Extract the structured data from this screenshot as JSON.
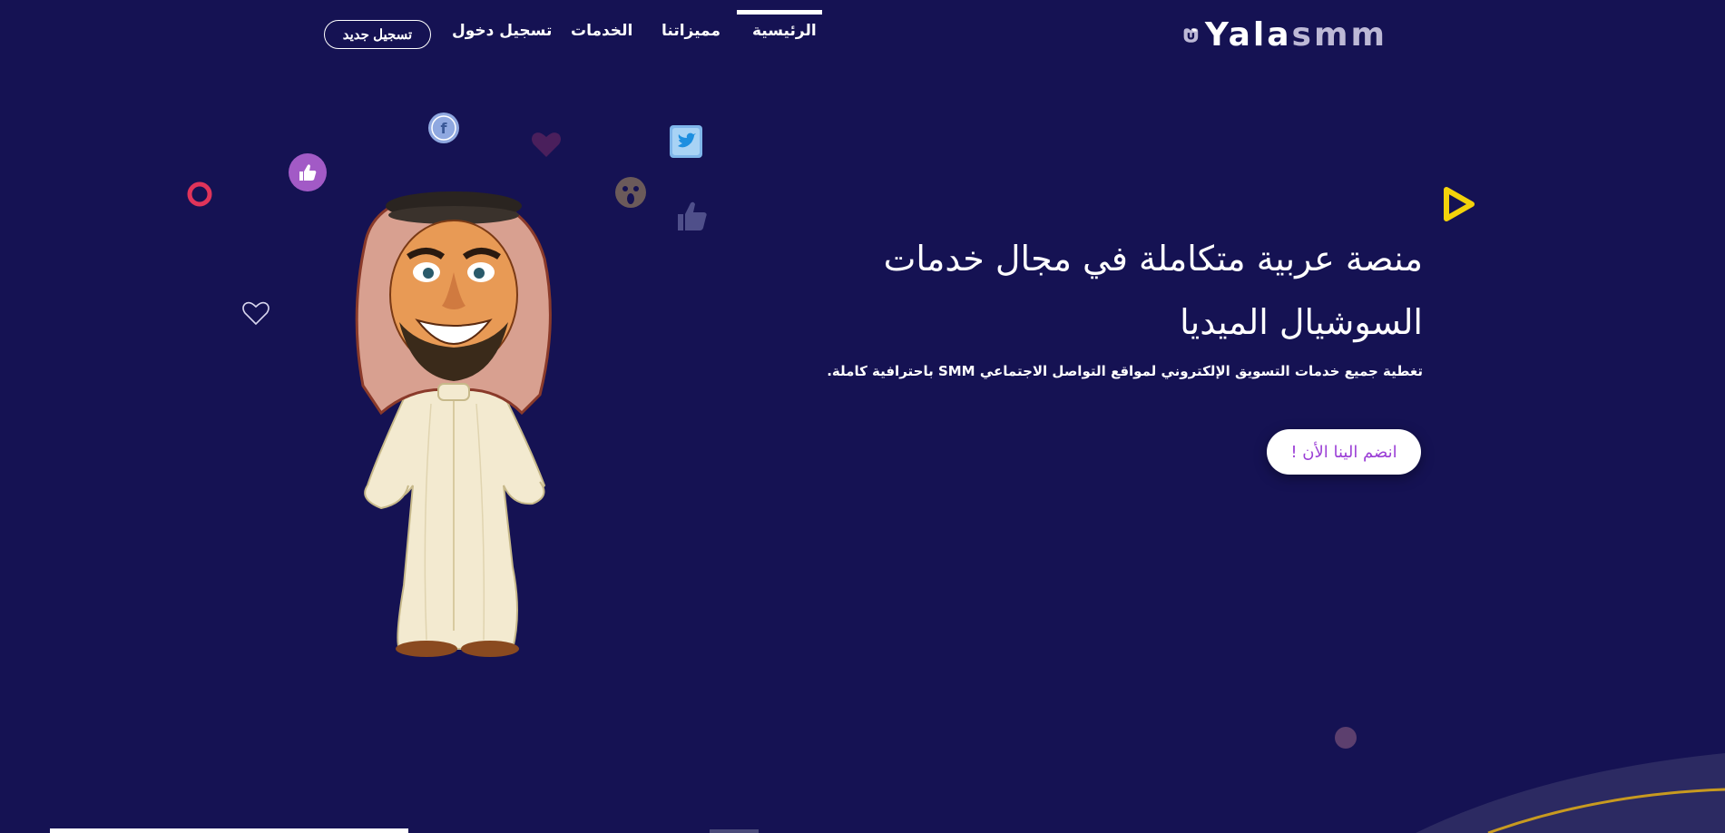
{
  "header": {
    "logo": {
      "text_main": "Yala",
      "text_accent": "smm"
    },
    "nav": [
      {
        "label": "الرئيسية",
        "active": true
      },
      {
        "label": "مميزاتنا",
        "active": false
      },
      {
        "label": "الخدمات",
        "active": false
      },
      {
        "label": "تسجيل دخول",
        "active": false
      }
    ],
    "register_label": "تسجيل جديد"
  },
  "hero": {
    "title": "منصة عربية متكاملة في مجال خدمات السوشيال الميديا",
    "subtitle": "تغطية جميع خدمات التسويق الإلكتروني لمواقع التواصل الاجتماعي SMM باحترافية كاملة.",
    "cta_label": "انضم الينا الأن !"
  },
  "floating_icons": [
    "facebook-icon",
    "twitter-icon",
    "thumbs-up-icon",
    "wow-emoji-icon",
    "heart-icon",
    "play-icon",
    "ring-icon",
    "outline-heart-icon"
  ],
  "colors": {
    "background": "#151253",
    "accent_purple": "#9b3fd6",
    "logo_accent": "#bdb9d6",
    "play_yellow": "#f3d20b",
    "ring_red": "#e0345a"
  }
}
